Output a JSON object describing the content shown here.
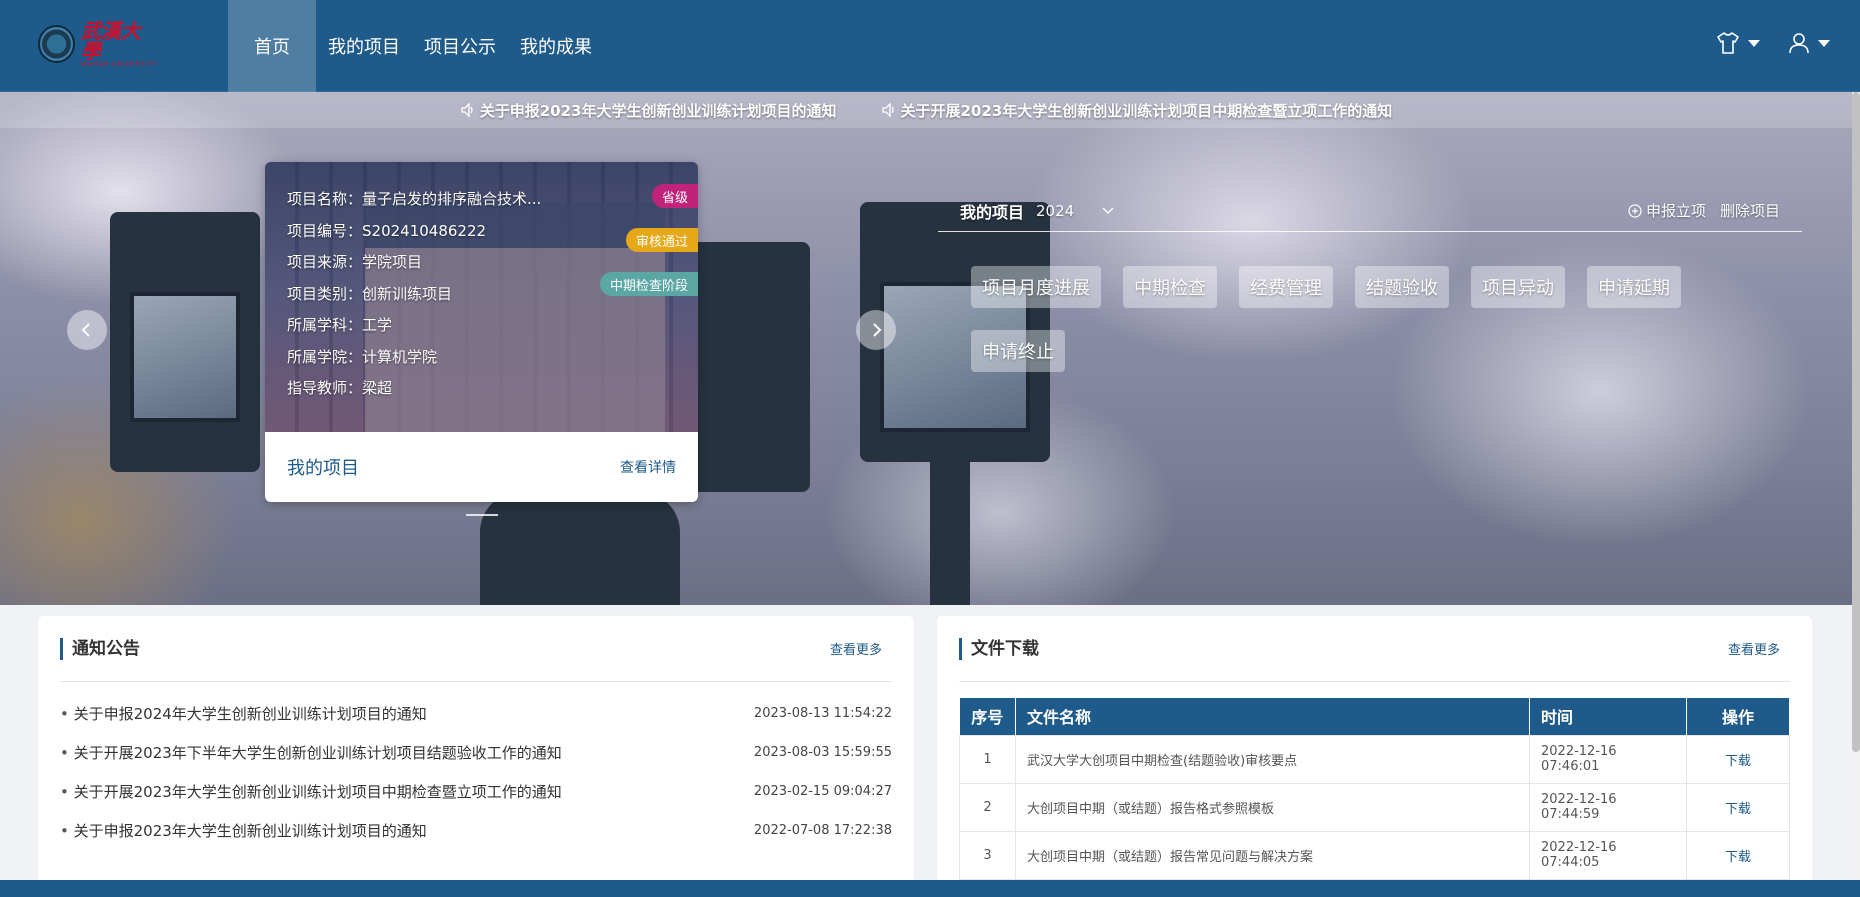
{
  "header": {
    "logo_text": "武漢大學",
    "logo_sub": "WUHAN UNIVERSITY",
    "nav": [
      {
        "label": "首页",
        "active": true
      },
      {
        "label": "我的项目",
        "active": false
      },
      {
        "label": "项目公示",
        "active": false
      },
      {
        "label": "我的成果",
        "active": false
      }
    ],
    "icons": [
      "shirt-icon",
      "user-icon"
    ]
  },
  "banner": {
    "notices": [
      "关于申报2023年大学生创新创业训练计划项目的通知",
      "关于开展2023年大学生创新创业训练计划项目中期检查暨立项工作的通知"
    ],
    "project_card": {
      "fields": [
        {
          "key": "项目名称：",
          "value": "量子启发的排序融合技术..."
        },
        {
          "key": "项目编号：",
          "value": "S202410486222"
        },
        {
          "key": "项目来源：",
          "value": "学院项目"
        },
        {
          "key": "项目类别：",
          "value": "创新训练项目"
        },
        {
          "key": "所属学科：",
          "value": "工学"
        },
        {
          "key": "所属学院：",
          "value": "计算机学院"
        },
        {
          "key": "指导教师：",
          "value": "梁超"
        }
      ],
      "badges": [
        {
          "label": "省级",
          "color": "#c2237a"
        },
        {
          "label": "审核通过",
          "color": "#e6a817"
        },
        {
          "label": "中期检查阶段",
          "color": "#5aa7a3"
        }
      ],
      "footer_title": "我的项目",
      "footer_link": "查看详情"
    },
    "right_panel": {
      "title": "我的项目",
      "year": "2024",
      "actions": [
        "申报立项",
        "删除项目"
      ],
      "tiles": [
        "项目月度进展",
        "中期检查",
        "经费管理",
        "结题验收",
        "项目异动",
        "申请延期",
        "申请终止"
      ]
    }
  },
  "notices_panel": {
    "title": "通知公告",
    "more": "查看更多",
    "items": [
      {
        "title": "关于申报2024年大学生创新创业训练计划项目的通知",
        "date": "2023-08-13 11:54:22"
      },
      {
        "title": "关于开展2023年下半年大学生创新创业训练计划项目结题验收工作的通知",
        "date": "2023-08-03 15:59:55"
      },
      {
        "title": "关于开展2023年大学生创新创业训练计划项目中期检查暨立项工作的通知",
        "date": "2023-02-15 09:04:27"
      },
      {
        "title": "关于申报2023年大学生创新创业训练计划项目的通知",
        "date": "2022-07-08 17:22:38"
      }
    ]
  },
  "files_panel": {
    "title": "文件下载",
    "more": "查看更多",
    "columns": [
      "序号",
      "文件名称",
      "时间",
      "操作"
    ],
    "rows": [
      {
        "no": "1",
        "name": "武汉大学大创项目中期检查(结题验收)审核要点",
        "time": "2022-12-16 07:46:01",
        "action": "下载"
      },
      {
        "no": "2",
        "name": "大创项目中期（或结题）报告格式参照模板",
        "time": "2022-12-16 07:44:59",
        "action": "下载"
      },
      {
        "no": "3",
        "name": "大创项目中期（或结题）报告常见问题与解决方案",
        "time": "2022-12-16 07:44:05",
        "action": "下载"
      }
    ]
  },
  "colors": {
    "primary": "#1e5a8a"
  }
}
